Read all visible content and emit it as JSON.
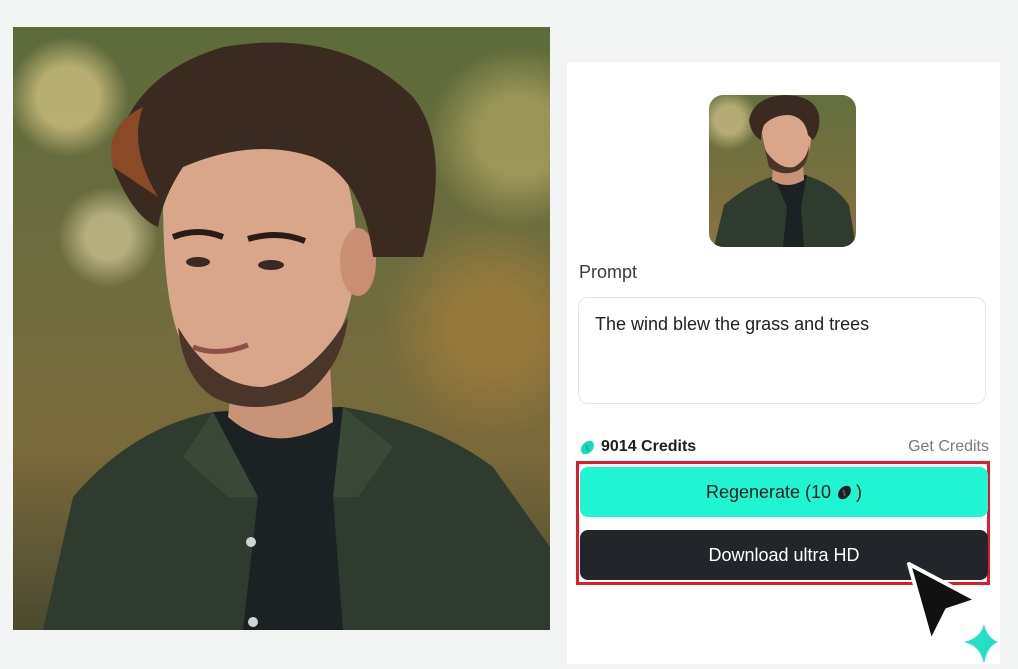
{
  "preview": {
    "image_label": "portrait-photo"
  },
  "panel": {
    "thumbnail_label": "portrait-thumbnail",
    "prompt_label": "Prompt",
    "prompt_value": "The wind blew the grass and trees",
    "credits_text": "9014 Credits",
    "get_credits_label": "Get Credits",
    "regenerate_label": "Regenerate (10",
    "regenerate_suffix": ")",
    "download_label": "Download ultra HD"
  },
  "colors": {
    "accent": "#1ff5d2",
    "dark_button": "#22252a",
    "highlight_border": "#e01c2a",
    "credit_icon": "#17d8bf"
  },
  "icons": {
    "credit": "credit-bean-icon",
    "cursor": "mouse-pointer-icon",
    "sparkle": "sparkle-icon"
  }
}
